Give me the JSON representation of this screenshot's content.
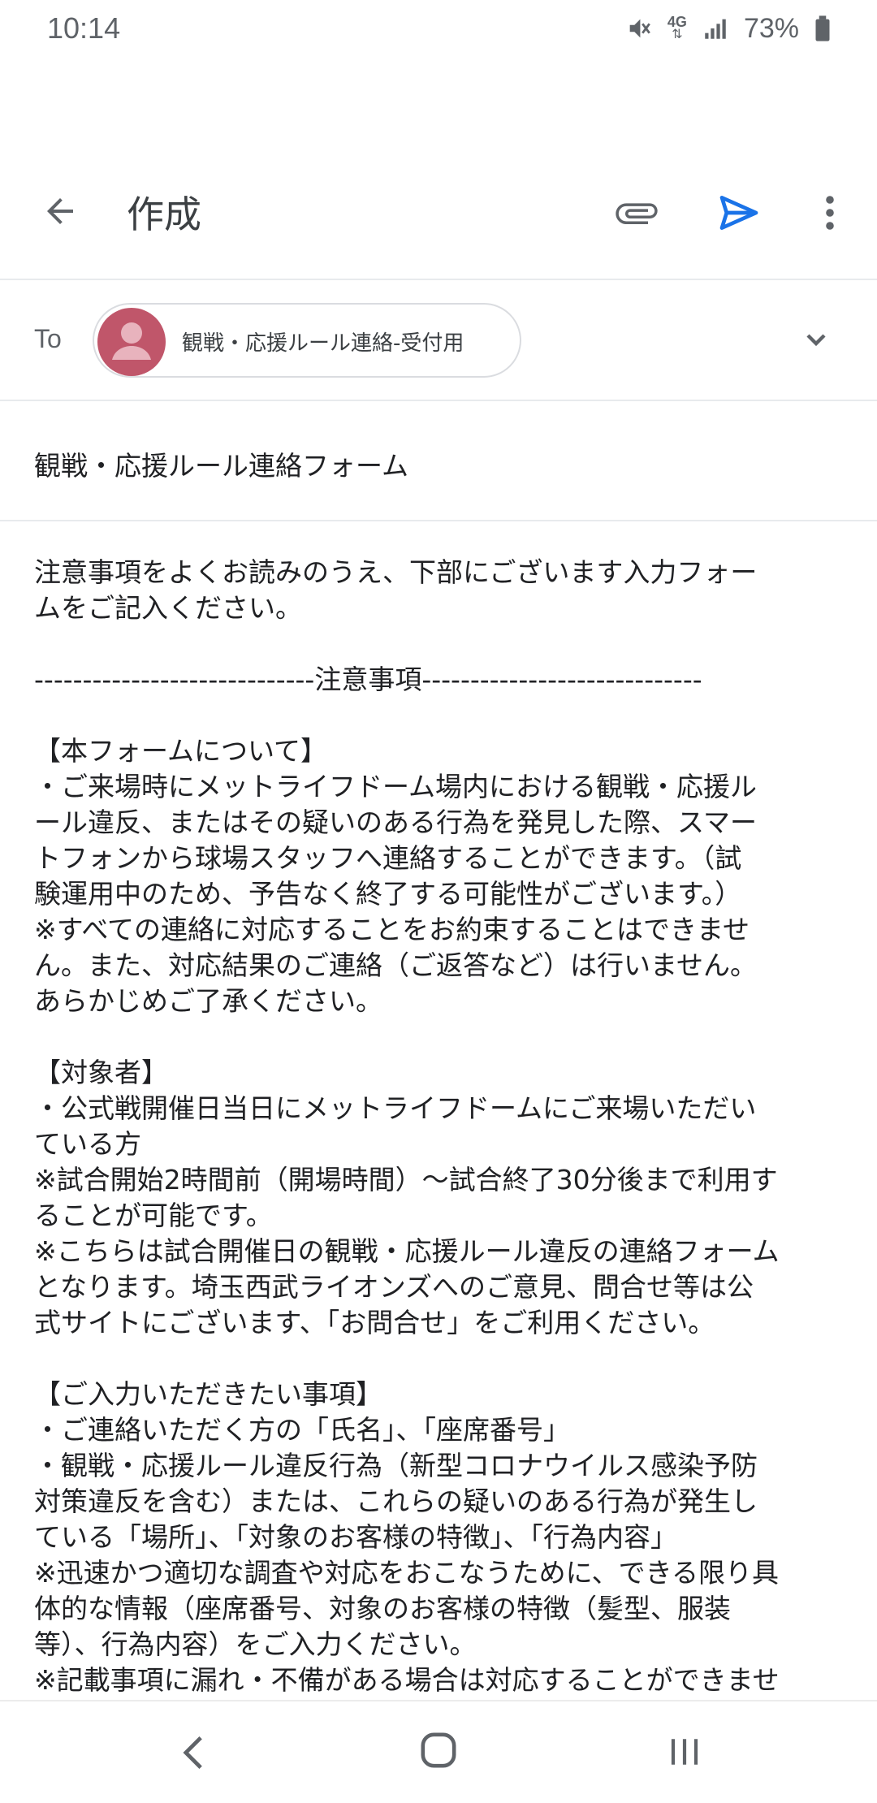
{
  "status_bar": {
    "time": "10:14",
    "network": "4G",
    "battery": "73%",
    "icons": [
      "mute-icon",
      "network-4g-icon",
      "signal-icon",
      "battery-icon"
    ]
  },
  "app_bar": {
    "title": "作成",
    "icons": [
      "back-arrow-icon",
      "attach-icon",
      "send-icon",
      "more-vert-icon"
    ],
    "accent_color": "#1a73e8"
  },
  "to_row": {
    "label": "To",
    "recipient": "観戦・応援ルール連絡-受付用",
    "avatar_color": "#c0566a"
  },
  "subject": "観戦・応援ルール連絡フォーム",
  "body_lines": [
    "注意事項をよくお読みのうえ、下部にございます入力フォー",
    "ムをご記入ください。",
    "",
    "-----------------------------注意事項-----------------------------",
    "",
    "【本フォームについて】",
    "・ご来場時にメットライフドーム場内における観戦・応援ル",
    "ール違反、またはその疑いのある行為を発見した際、スマー",
    "トフォンから球場スタッフへ連絡することができます。（試",
    "験運用中のため、予告なく終了する可能性がございます。）",
    "※すべての連絡に対応することをお約束することはできませ",
    "ん。また、対応結果のご連絡（ご返答など）は行いません。",
    "あらかじめご了承ください。",
    "",
    "【対象者】",
    "・公式戦開催日当日にメットライフドームにご来場いただい",
    "ている方",
    "※試合開始2時間前（開場時間）〜試合終了30分後まで利用す",
    "ることが可能です。",
    "※こちらは試合開催日の観戦・応援ルール違反の連絡フォーム",
    "となります。埼玉西武ライオンズへのご意見、問合せ等は公",
    "式サイトにございます、「お問合せ」をご利用ください。",
    "",
    "【ご入力いただきたい事項】",
    "・ご連絡いただく方の「氏名」、「座席番号」",
    "・観戦・応援ルール違反行為（新型コロナウイルス感染予防",
    "対策違反を含む）または、これらの疑いのある行為が発生し",
    "ている「場所」、「対象のお客様の特徴」、「行為内容」",
    "※迅速かつ適切な調査や対応をおこなうために、できる限り具",
    "体的な情報（座席番号、対象のお客様の特徴（髪型、服装",
    "等）、行為内容）をご入力ください。",
    "※記載事項に漏れ・不備がある場合は対応することができませ"
  ],
  "nav_bar": {
    "icons": [
      "nav-back-icon",
      "nav-home-icon",
      "nav-recents-icon"
    ]
  }
}
